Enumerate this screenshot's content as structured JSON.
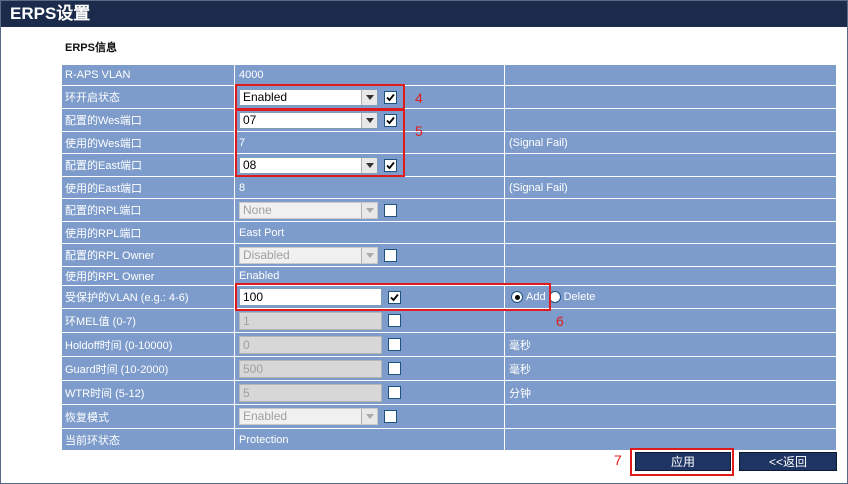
{
  "window": {
    "title": "ERPS设置"
  },
  "section": {
    "title": "ERPS信息"
  },
  "rows": {
    "raps_vlan": {
      "label": "R-APS VLAN",
      "value": "4000"
    },
    "ring_state": {
      "label": "环开启状态",
      "value": "Enabled"
    },
    "cfg_west": {
      "label": "配置的Wes端口",
      "value": "07"
    },
    "used_west": {
      "label": "使用的Wes端口",
      "value": "7",
      "status": "(Signal Fail)"
    },
    "cfg_east": {
      "label": "配置的East端口",
      "value": "08"
    },
    "used_east": {
      "label": "使用的East端口",
      "value": "8",
      "status": "(Signal Fail)"
    },
    "cfg_rpl": {
      "label": "配置的RPL端口",
      "value": "None"
    },
    "used_rpl": {
      "label": "使用的RPL端口",
      "value": "East Port"
    },
    "cfg_rpl_owner": {
      "label": "配置的RPL Owner",
      "value": "Disabled"
    },
    "used_rpl_owner": {
      "label": "使用的RPL Owner",
      "value": "Enabled"
    },
    "protected_vlan": {
      "label": "受保护的VLAN (e.g.: 4-6)",
      "value": "100",
      "add_label": "Add",
      "delete_label": "Delete"
    },
    "mel": {
      "label": "环MEL值 (0-7)",
      "value": "1"
    },
    "holdoff": {
      "label": "Holdoff时间 (0-10000)",
      "value": "0",
      "unit": "毫秒"
    },
    "guard": {
      "label": "Guard时间 (10-2000)",
      "value": "500",
      "unit": "毫秒"
    },
    "wtr": {
      "label": "WTR时间 (5-12)",
      "value": "5",
      "unit": "分钟"
    },
    "recovery": {
      "label": "恢复模式",
      "value": "Enabled"
    },
    "current_state": {
      "label": "当前环状态",
      "value": "Protection"
    }
  },
  "annotations": {
    "a4": "4",
    "a5": "5",
    "a6": "6",
    "a7": "7"
  },
  "buttons": {
    "apply": "应用",
    "back": "<<返回"
  },
  "colors": {
    "titlebar": "#1a2b4c",
    "row": "#7d9ccb",
    "highlight": "#e01b1b",
    "button": "#1e3563"
  }
}
